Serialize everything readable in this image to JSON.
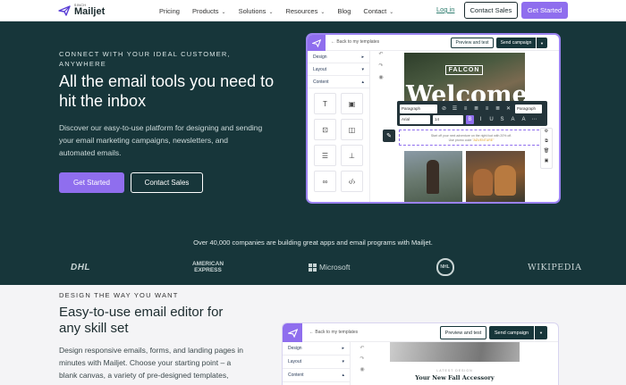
{
  "nav": {
    "logo_sinch": "SINCH",
    "logo_name": "Mailjet",
    "links": [
      {
        "label": "Pricing",
        "dropdown": false
      },
      {
        "label": "Products",
        "dropdown": true
      },
      {
        "label": "Solutions",
        "dropdown": true
      },
      {
        "label": "Resources",
        "dropdown": true
      },
      {
        "label": "Blog",
        "dropdown": false
      },
      {
        "label": "Contact",
        "dropdown": true
      }
    ],
    "login": "Log in",
    "contact_sales": "Contact Sales",
    "get_started": "Get Started"
  },
  "hero": {
    "eyebrow": "CONNECT WITH YOUR IDEAL CUSTOMER, ANYWHERE",
    "title": "All the email tools you need to hit the inbox",
    "description": "Discover our easy-to-use platform for designing and sending your email marketing campaigns, newsletters, and automated emails.",
    "primary_button": "Get Started",
    "secondary_button": "Contact Sales"
  },
  "editor": {
    "back": "← Back to my templates",
    "preview": "Preview and test",
    "send": "Send campaign",
    "sidebar": {
      "design": "Design",
      "layout": "Layout",
      "content": "Content"
    },
    "falcon": "FALCON",
    "welcome": "Welcome",
    "format_bar": {
      "style_select": "Paragraph",
      "font_select": "Arial",
      "size_select": "14",
      "paragraph_button": "Paragraph"
    },
    "selected_text_line1": "Start off your next adventure on the right foot with 20% off.",
    "selected_text_line2": "Use promo code",
    "promo_code": "\"ADVENTURE\""
  },
  "companies": {
    "text": "Over 40,000 companies are building great apps and email programs with Mailjet.",
    "logos": {
      "dhl": "DHL",
      "amex_line1": "AMERICAN",
      "amex_line2": "EXPRESS",
      "microsoft": "Microsoft",
      "nhl": "NHL",
      "wikipedia": "WIKIPEDIA"
    }
  },
  "section2": {
    "eyebrow": "DESIGN THE WAY YOU WANT",
    "title": "Easy-to-use email editor for any skill set",
    "description": "Design responsive emails, forms, and landing pages in minutes with Mailjet. Choose your starting point – a blank canvas, a variety of pre-designed templates,",
    "editor": {
      "back": "← Back to my templates",
      "preview": "Preview and test",
      "send": "Send campaign",
      "design": "Design",
      "layout": "Layout",
      "content": "Content",
      "latest": "LATEST DESIGN",
      "headline": "Your New Fall Accessory"
    }
  },
  "colors": {
    "accent": "#8f6eee",
    "hero_bg": "#17363a",
    "page_bg": "#f4f4f6"
  }
}
